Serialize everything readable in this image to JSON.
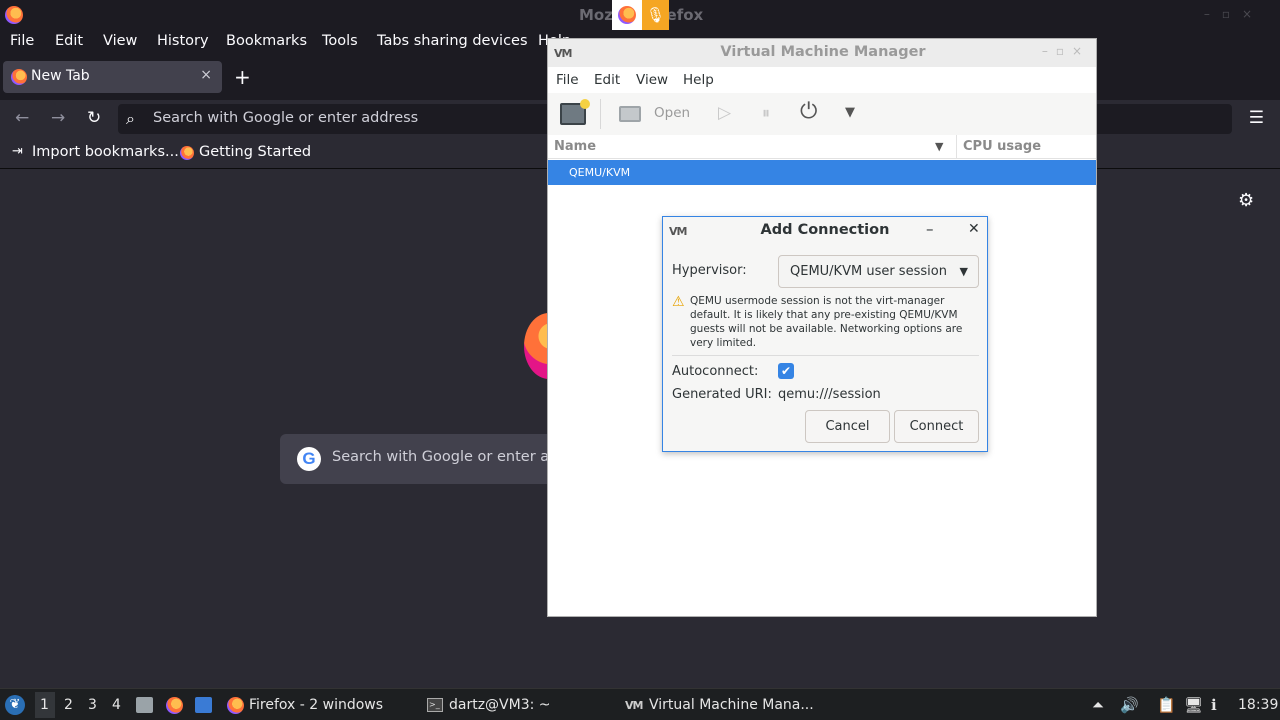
{
  "firefox": {
    "window_title": "Mozilla Firefox",
    "menu": [
      "File",
      "Edit",
      "View",
      "History",
      "Bookmarks",
      "Tools",
      "Tabs sharing devices",
      "Help"
    ],
    "tab": {
      "label": "New Tab",
      "close": "×"
    },
    "new_tab": "+",
    "address_placeholder": "Search with Google or enter address",
    "bookmarks": [
      "Import bookmarks...",
      "Getting Started"
    ],
    "content_search_placeholder": "Search with Google or enter address",
    "sharing_indicator_icons": [
      "firefox-icon",
      "microphone-icon"
    ]
  },
  "vmm": {
    "title": "Virtual Machine Manager",
    "menu": [
      "File",
      "Edit",
      "View",
      "Help"
    ],
    "toolbar": {
      "open_label": "Open"
    },
    "columns": [
      "Name",
      "CPU usage"
    ],
    "rows": [
      "QEMU/KVM"
    ]
  },
  "dialog": {
    "title": "Add Connection",
    "hypervisor_label": "Hypervisor:",
    "hypervisor_value": "QEMU/KVM user session",
    "warning_text": "QEMU usermode session is not the virt-manager default. It is likely that any pre-existing QEMU/KVM guests will not be available. Networking options are very limited.",
    "autoconnect_label": "Autoconnect:",
    "autoconnect_checked": true,
    "uri_label": "Generated URI:",
    "uri_value": "qemu:///session",
    "cancel_label": "Cancel",
    "connect_label": "Connect"
  },
  "taskbar": {
    "workspaces": [
      "1",
      "2",
      "3",
      "4"
    ],
    "active_workspace": "1",
    "tasks": [
      "Firefox - 2 windows",
      "dartz@VM3: ~",
      "Virtual Machine Mana..."
    ],
    "clock": "18:39"
  },
  "colors": {
    "accent": "#3584e4",
    "firefox_bg": "#2b2a33",
    "firefox_chrome": "#1c1b22",
    "sharing_indicator": "#f5a623"
  }
}
